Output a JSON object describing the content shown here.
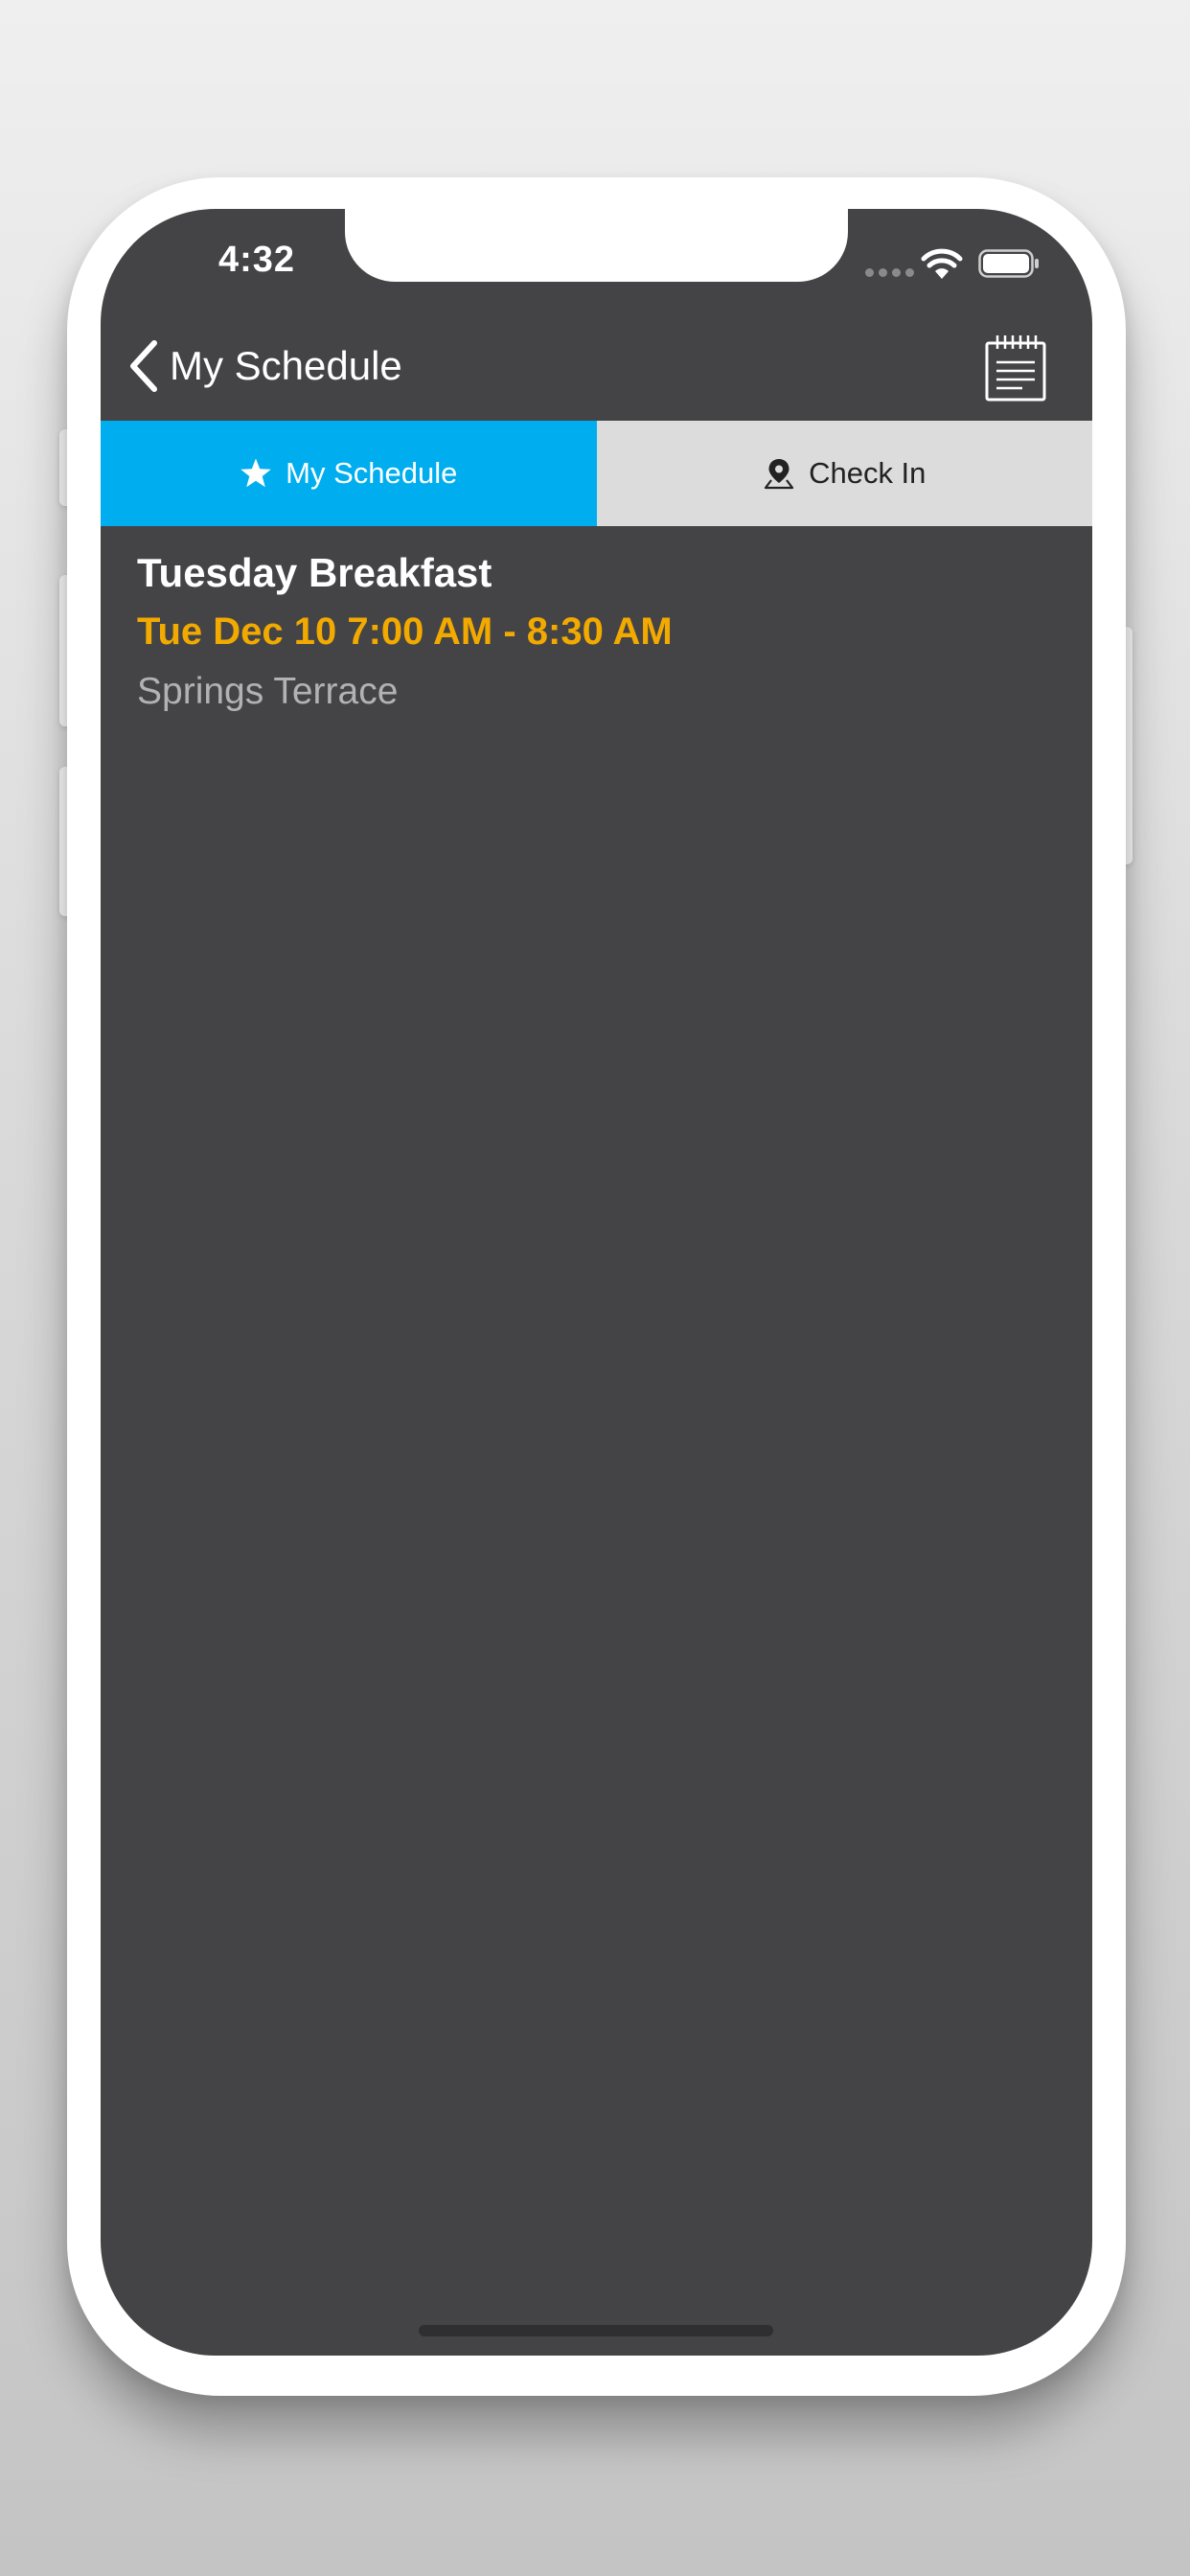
{
  "status_bar": {
    "time": "4:32",
    "wifi_icon": "wifi-icon",
    "battery_icon": "battery-icon"
  },
  "nav": {
    "back_icon": "chevron-left-icon",
    "title": "My Schedule",
    "notes_icon": "notepad-icon"
  },
  "tabs": [
    {
      "label": "My Schedule",
      "icon": "star-icon",
      "active": true
    },
    {
      "label": "Check In",
      "icon": "map-pin-icon",
      "active": false
    }
  ],
  "events": [
    {
      "title": "Tuesday Breakfast",
      "time": "Tue Dec 10 7:00 AM - 8:30 AM",
      "location": "Springs Terrace"
    }
  ],
  "colors": {
    "accent": "#00aeef",
    "time_text": "#f2a900",
    "screen_background": "#444446",
    "inactive_tab": "#dcdcdc"
  }
}
